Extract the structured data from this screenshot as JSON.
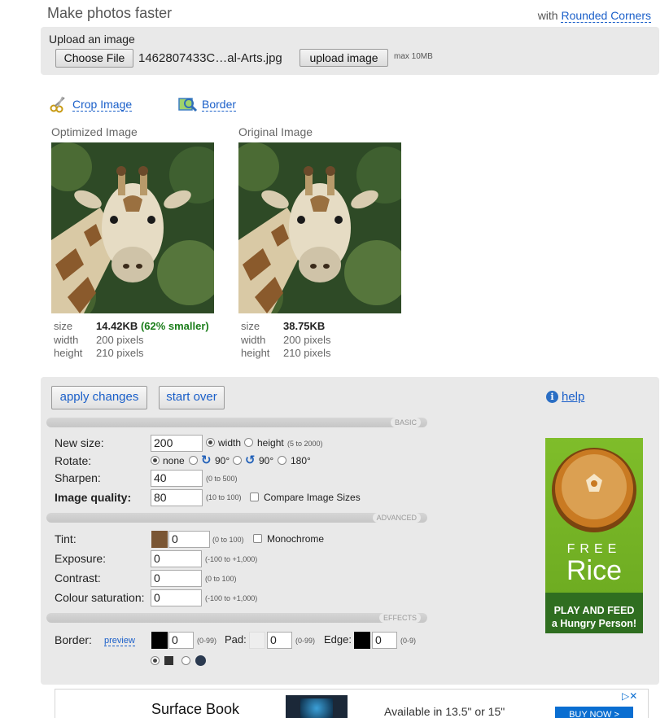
{
  "header": {
    "title": "Make photos faster",
    "with_prefix": "with",
    "with_link": "Rounded Corners"
  },
  "upload": {
    "label": "Upload an image",
    "choose_file": "Choose File",
    "filename": "1462807433C…al-Arts.jpg",
    "upload_button": "upload image",
    "max_size": "max 10MB"
  },
  "tools": {
    "crop": "Crop Image",
    "border": "Border"
  },
  "optimized": {
    "caption": "Optimized Image",
    "size_label": "size",
    "size_value": "14.42KB",
    "savings": "(62% smaller)",
    "width_label": "width",
    "width_value": "200 pixels",
    "height_label": "height",
    "height_value": "210 pixels"
  },
  "original": {
    "caption": "Original Image",
    "size_label": "size",
    "size_value": "38.75KB",
    "width_label": "width",
    "width_value": "200 pixels",
    "height_label": "height",
    "height_value": "210 pixels"
  },
  "actions": {
    "apply": "apply changes",
    "start_over": "start over",
    "help": "help"
  },
  "basic": {
    "section": "BASIC",
    "new_size_label": "New size:",
    "new_size_value": "200",
    "width_opt": "width",
    "height_opt": "height",
    "size_hint": "(5 to 2000)",
    "rotate_label": "Rotate:",
    "rotate_none": "none",
    "rotate_cw": "90°",
    "rotate_ccw": "90°",
    "rotate_180": "180°",
    "sharpen_label": "Sharpen:",
    "sharpen_value": "40",
    "sharpen_hint": "(0 to 500)",
    "quality_label": "Image quality:",
    "quality_value": "80",
    "quality_hint": "(10 to 100)",
    "compare_label": "Compare Image Sizes"
  },
  "advanced": {
    "section": "ADVANCED",
    "tint_label": "Tint:",
    "tint_value": "0",
    "tint_hint": "(0 to 100)",
    "tint_color": "#7a5634",
    "monochrome_label": "Monochrome",
    "exposure_label": "Exposure:",
    "exposure_value": "0",
    "exposure_hint": "(-100 to +1,000)",
    "contrast_label": "Contrast:",
    "contrast_value": "0",
    "contrast_hint": "(0 to 100)",
    "saturation_label": "Colour saturation:",
    "saturation_value": "0",
    "saturation_hint": "(-100 to +1,000)"
  },
  "effects": {
    "section": "EFFECTS",
    "border_label": "Border:",
    "preview_link": "preview",
    "border_value": "0",
    "border_hint": "(0-99)",
    "pad_label": "Pad:",
    "pad_value": "0",
    "pad_hint": "(0-99)",
    "edge_label": "Edge:",
    "edge_value": "0",
    "edge_hint": "(0-9)"
  },
  "side_ad": {
    "free": "FREE",
    "rice": "Rice",
    "play": "PLAY AND FEED",
    "hungry": "a Hungry Person!"
  },
  "bottom_ad": {
    "product": "Surface Book",
    "availability": "Available in 13.5\" or 15\"",
    "buy": "BUY NOW  >"
  },
  "colors": {
    "link": "#1a5fc9",
    "panel": "#e9e9e9",
    "savings_green": "#1a7d1a",
    "ad_green": "#7fbd2a"
  }
}
